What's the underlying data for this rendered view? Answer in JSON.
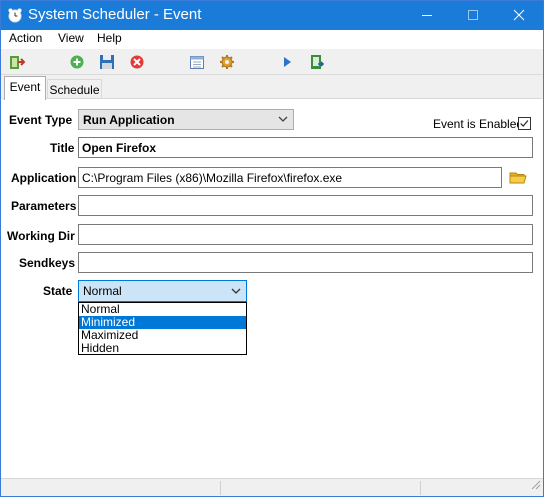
{
  "window": {
    "title": "System Scheduler - Event"
  },
  "menu": {
    "items": [
      "Action",
      "View",
      "Help"
    ]
  },
  "toolbar": {
    "buttons": [
      "exit-icon",
      "add-icon",
      "save-icon",
      "delete-icon",
      "calendar-icon",
      "settings-icon",
      "run-icon",
      "log-icon"
    ]
  },
  "tabs": [
    {
      "label": "Event",
      "active": true
    },
    {
      "label": "Schedule",
      "active": false
    }
  ],
  "form": {
    "event_type_label": "Event Type",
    "event_type_value": "Run Application",
    "event_enabled_label": "Event is Enabled",
    "event_enabled_checked": true,
    "title_label": "Title",
    "title_value": "Open Firefox",
    "application_label": "Application",
    "application_value": "C:\\Program Files (x86)\\Mozilla Firefox\\firefox.exe",
    "parameters_label": "Parameters",
    "parameters_value": "",
    "working_dir_label": "Working Dir",
    "working_dir_value": "",
    "sendkeys_label": "Sendkeys",
    "sendkeys_value": "",
    "state_label": "State",
    "state_value": "Normal",
    "state_options": [
      "Normal",
      "Minimized",
      "Maximized",
      "Hidden"
    ],
    "state_highlighted": "Minimized"
  },
  "colors": {
    "titlebar": "#1a7cd8",
    "selection": "#0078d7",
    "combo_focus": "#cce4f7"
  }
}
